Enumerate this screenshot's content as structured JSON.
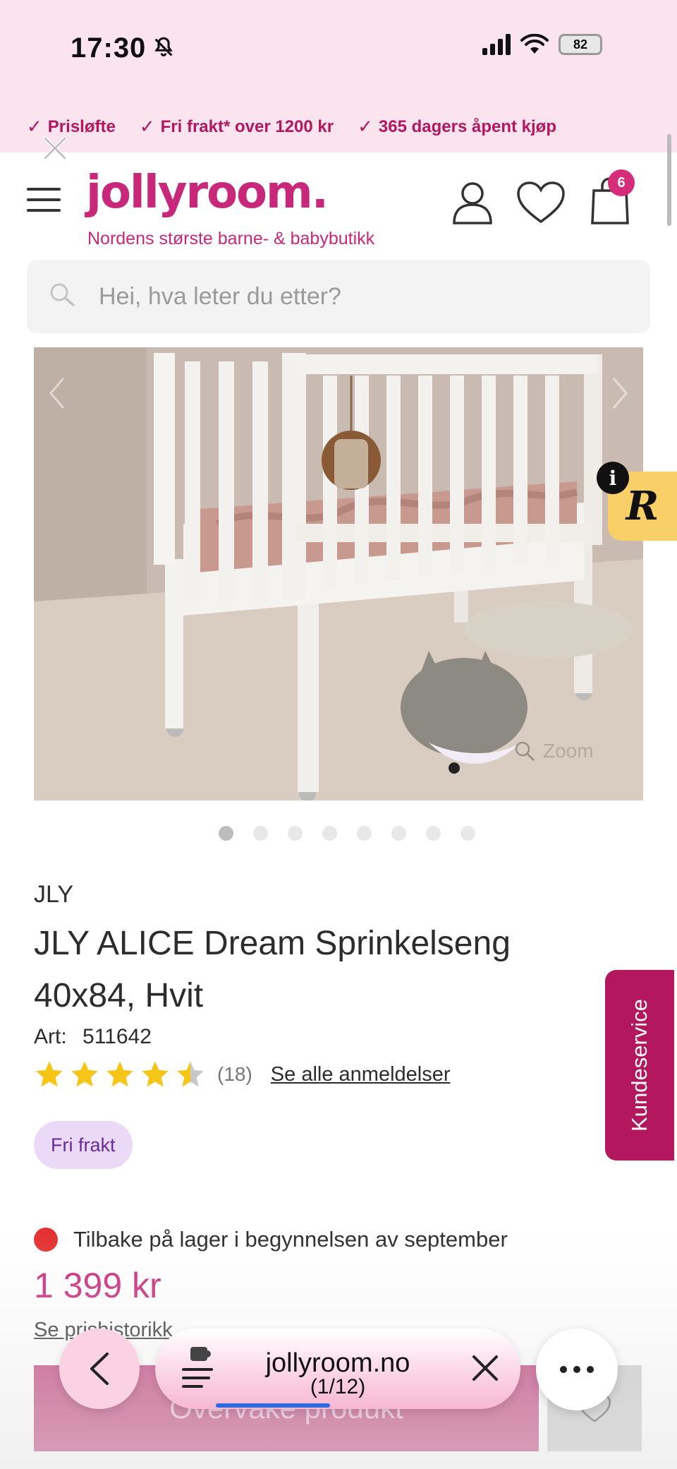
{
  "status_bar": {
    "time": "17:30",
    "battery": "82"
  },
  "usp": [
    {
      "label": "Prisløfte"
    },
    {
      "label": "Fri frakt* over 1200 kr"
    },
    {
      "label": "365 dagers åpent kjøp"
    }
  ],
  "header": {
    "logo": "jollyroom.",
    "tagline": "Nordens største barne- & babybutikk",
    "cart_count": "6"
  },
  "search": {
    "placeholder": "Hei, hva leter du etter?"
  },
  "gallery": {
    "zoom_label": "Zoom",
    "image_count": 8,
    "active_index": 0
  },
  "floating": {
    "badge_letter": "R",
    "info_letter": "i",
    "kundeservice": "Kundeservice"
  },
  "product": {
    "brand": "JLY",
    "title": "JLY ALICE Dream Sprinkelseng 40x84, Hvit",
    "art_label": "Art:",
    "art_number": "511642",
    "rating": 4.5,
    "review_count": "(18)",
    "review_link": "Se alle anmeldelser",
    "badge": "Fri frakt",
    "stock_text": "Tilbake på lager i begynnelsen av september",
    "price": "1 399 kr",
    "price_history": "Se prishistorikk",
    "cta": "Overvåke produkt"
  },
  "browser": {
    "domain": "jollyroom.no",
    "tab_counter": "(1/12)"
  },
  "colors": {
    "brand": "#c7287a",
    "usp": "#b3185f",
    "badge_bg": "#ead9f7",
    "stock": "#e3302f",
    "star": "#f5c518"
  }
}
